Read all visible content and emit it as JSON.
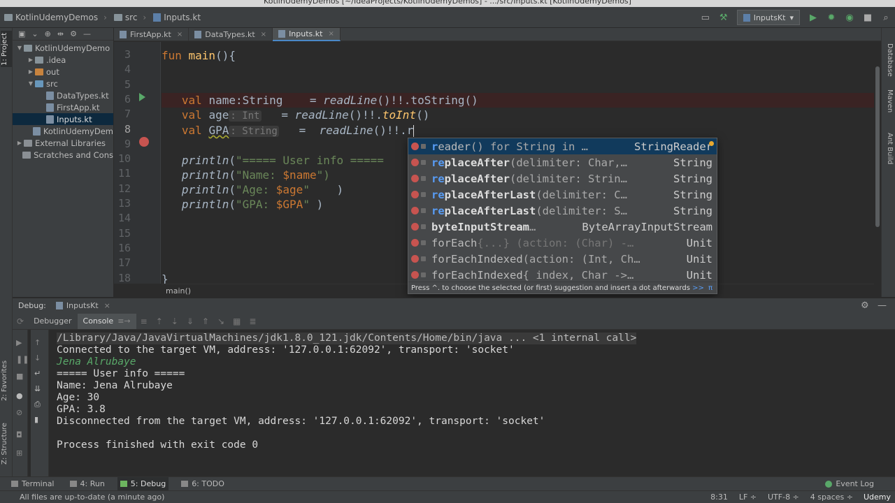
{
  "window_title": "KotlinUdemyDemos [~/IdeaProjects/KotlinUdemyDemos] - .../src/Inputs.kt [KotlinUdemyDemos]",
  "navbar": {
    "crumbs": [
      "KotlinUdemyDemos",
      "src",
      "Inputs.kt"
    ],
    "run_config": "InputsKt"
  },
  "left_strip": {
    "project_tab": "1: Project",
    "favorites_tab": "2: Favorites",
    "structure_tab": "Z: Structure"
  },
  "right_strip": {
    "database": "Database",
    "maven": "Maven",
    "ant": "Ant Build"
  },
  "project_tree": [
    {
      "label": "KotlinUdemyDemo",
      "indent": 0,
      "arrow": "▼",
      "icon": "folder"
    },
    {
      "label": ".idea",
      "indent": 1,
      "arrow": "▶",
      "icon": "folder"
    },
    {
      "label": "out",
      "indent": 1,
      "arrow": "▶",
      "icon": "orange"
    },
    {
      "label": "src",
      "indent": 1,
      "arrow": "▼",
      "icon": "blue"
    },
    {
      "label": "DataTypes.kt",
      "indent": 2,
      "arrow": "",
      "icon": "kt"
    },
    {
      "label": "FirstApp.kt",
      "indent": 2,
      "arrow": "",
      "icon": "kt"
    },
    {
      "label": "Inputs.kt",
      "indent": 2,
      "arrow": "",
      "icon": "kt",
      "selected": true
    },
    {
      "label": "KotlinUdemyDem",
      "indent": 1,
      "arrow": "",
      "icon": "kt"
    },
    {
      "label": "External Libraries",
      "indent": 0,
      "arrow": "▶",
      "icon": "lib"
    },
    {
      "label": "Scratches and Cons",
      "indent": 0,
      "arrow": "",
      "icon": "lib"
    }
  ],
  "editor_tabs": [
    {
      "label": "FirstApp.kt",
      "active": false
    },
    {
      "label": "DataTypes.kt",
      "active": false
    },
    {
      "label": "Inputs.kt",
      "active": true
    }
  ],
  "line_numbers": [
    "3",
    "4",
    "5",
    "6",
    "7",
    "8",
    "9",
    "10",
    "11",
    "12",
    "13",
    "14",
    "15",
    "16",
    "17",
    "18"
  ],
  "code": {
    "l3_kw": "fun ",
    "l3_fn": "main",
    "l3_rest": "(){",
    "l6_kw": "val ",
    "l6_a": "name:String    = ",
    "l6_b": "readLine",
    "l6_c": "()!!.toString()",
    "l7_kw": "val ",
    "l7_a": "age",
    "l7_hint": ": Int",
    "l7_b": "   = ",
    "l7_c": "readLine",
    "l7_d": "()!!.",
    "l7_e": "toInt",
    "l7_f": "()",
    "l8_kw": "val ",
    "l8_a": "GPA",
    "l8_hint": ": String",
    "l8_b": "   =  ",
    "l8_c": "readLine",
    "l8_d": "()!!.r",
    "l10_fn": "println",
    "l10_a": "(",
    "l10_s": "\"===== User info =====",
    "l11_fn": "println",
    "l11_a": "(",
    "l11_s": "\"Name: ",
    "l11_v": "$name",
    "l11_e": "\")",
    "l12_fn": "println",
    "l12_a": "(",
    "l12_s": "\"Age: ",
    "l12_v": "$age",
    "l12_q": "\"",
    "l12_e": "    )",
    "l13_fn": "println",
    "l13_a": "(",
    "l13_s": "\"GPA: ",
    "l13_v": "$GPA",
    "l13_q": "\"",
    "l13_e": " )",
    "l18": "}"
  },
  "bottom_breadcrumb": "main()",
  "completion": {
    "items": [
      {
        "match": "r",
        "rest": "eader",
        "args": "() for String in …",
        "type": "StringReader",
        "selected": true
      },
      {
        "match": "re",
        "rest": "placeAfter",
        "args": "(delimiter: Char,…",
        "type": "String",
        "bold": true
      },
      {
        "match": "re",
        "rest": "placeAfter",
        "args": "(delimiter: Strin…",
        "type": "String",
        "bold": true
      },
      {
        "match": "re",
        "rest": "placeAfterLast",
        "args": "(delimiter: C…",
        "type": "String",
        "bold": true
      },
      {
        "match": "re",
        "rest": "placeAfterLast",
        "args": "(delimiter: S…",
        "type": "String",
        "bold": true
      },
      {
        "match": "",
        "rest": "byteInputStream",
        "args": "…",
        "type": "ByteArrayInputStream",
        "bold": true
      },
      {
        "match": "",
        "rest": "forEach",
        "args": " {...} (action: (Char) -…",
        "type": "Unit"
      },
      {
        "match": "",
        "rest": "forEachIndexed",
        "args": "(action: (Int, Ch…",
        "type": "Unit"
      },
      {
        "match": "",
        "rest": "forEachIndexed",
        "args": " { index, Char ->…",
        "type": "Unit"
      }
    ],
    "footer": "Press ^. to choose the selected (or first) suggestion and insert a dot afterwards",
    "footer_link": ">>",
    "footer_pi": "π"
  },
  "debug": {
    "label": "Debug:",
    "config": "InputsKt",
    "tab_debugger": "Debugger",
    "tab_console": "Console"
  },
  "console_lines": [
    {
      "text": "/Library/Java/JavaVirtualMachines/jdk1.8.0_121.jdk/Contents/Home/bin/java ... <1 internal call>",
      "kind": "gray"
    },
    {
      "text": "Connected to the target VM, address: '127.0.0.1:62092', transport: 'socket'",
      "kind": "normal"
    },
    {
      "text": "Jena Alrubaye",
      "kind": "input"
    },
    {
      "text": "===== User info =====",
      "kind": "normal"
    },
    {
      "text": "Name: Jena Alrubaye",
      "kind": "normal"
    },
    {
      "text": "Age: 30",
      "kind": "normal"
    },
    {
      "text": "GPA: 3.8",
      "kind": "normal"
    },
    {
      "text": "Disconnected from the target VM, address: '127.0.0.1:62092', transport: 'socket'",
      "kind": "normal"
    },
    {
      "text": "",
      "kind": "empty"
    },
    {
      "text": "Process finished with exit code 0",
      "kind": "normal"
    }
  ],
  "bottom_tabs": [
    {
      "label": "Terminal",
      "active": false
    },
    {
      "label": "4: Run",
      "active": false
    },
    {
      "label": "5: Debug",
      "active": true
    },
    {
      "label": "6: TODO",
      "active": false
    }
  ],
  "event_log": "Event Log",
  "status": {
    "message": "All files are up-to-date (a minute ago)",
    "position": "8:31",
    "line_sep": "LF ÷",
    "encoding": "UTF-8 ÷",
    "indent": "4 spaces ÷"
  },
  "watermark": "Udemy"
}
